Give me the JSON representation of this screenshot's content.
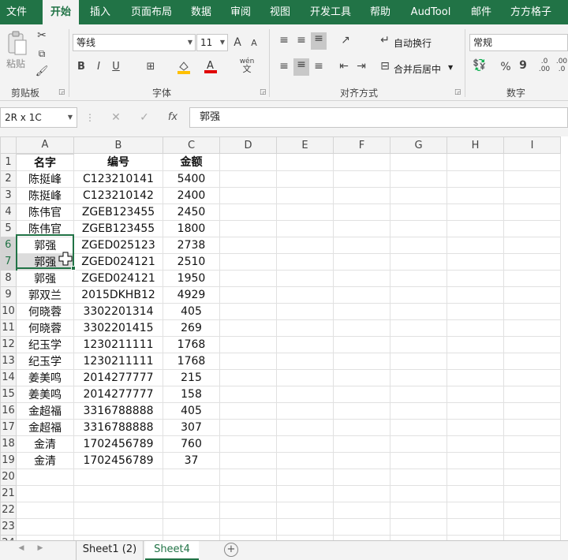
{
  "menu": {
    "tabs": [
      "文件",
      "开始",
      "插入",
      "页面布局",
      "数据",
      "审阅",
      "视图",
      "开发工具",
      "帮助",
      "AudTool",
      "邮件",
      "方方格子"
    ],
    "active": "开始"
  },
  "ribbon": {
    "clipboard": {
      "paste_label": "粘贴",
      "group_label": "剪贴板"
    },
    "font": {
      "font_name": "等线",
      "font_size": "11",
      "grow": "A",
      "shrink": "A",
      "bold": "B",
      "italic": "I",
      "underline": "U",
      "wen": "wén",
      "wen_sub": "文",
      "group_label": "字体"
    },
    "alignment": {
      "wrap_label": "自动换行",
      "merge_label": "合并后居中",
      "group_label": "对齐方式"
    },
    "number": {
      "format": "常规",
      "percent": "%",
      "comma": "9",
      "inc_dec": ".0",
      "inc_dec2": ".00",
      "group_label": "数字"
    }
  },
  "formula_bar": {
    "name_box": "2R x 1C",
    "fx": "fx",
    "content": "郭强"
  },
  "columns": [
    "A",
    "B",
    "C",
    "D",
    "E",
    "F",
    "G",
    "H",
    "I"
  ],
  "rows": [
    [
      "名字",
      "编号",
      "金额"
    ],
    [
      "陈挺峰",
      "C123210141",
      "5400"
    ],
    [
      "陈挺峰",
      "C123210142",
      "2400"
    ],
    [
      "陈伟官",
      "ZGEB123455",
      "2450"
    ],
    [
      "陈伟官",
      "ZGEB123455",
      "1800"
    ],
    [
      "郭强",
      "ZGED025123",
      "2738"
    ],
    [
      "郭强",
      "ZGED024121",
      "2510"
    ],
    [
      "郭强",
      "ZGED024121",
      "1950"
    ],
    [
      "郭双兰",
      "2015DKHB12",
      "4929"
    ],
    [
      "何晓蓉",
      "3302201314",
      "405"
    ],
    [
      "何晓蓉",
      "3302201415",
      "269"
    ],
    [
      "纪玉学",
      "1230211111",
      "1768"
    ],
    [
      "纪玉学",
      "1230211111",
      "1768"
    ],
    [
      "姜美鸣",
      "2014277777",
      "215"
    ],
    [
      "姜美鸣",
      "2014277777",
      "158"
    ],
    [
      "金超福",
      "3316788888",
      "405"
    ],
    [
      "金超福",
      "3316788888",
      "307"
    ],
    [
      "金清",
      "1702456789",
      "760"
    ],
    [
      "金清",
      "1702456789",
      "37"
    ],
    [
      "",
      "",
      ""
    ],
    [
      "",
      "",
      ""
    ],
    [
      "",
      "",
      ""
    ],
    [
      "",
      "",
      ""
    ],
    [
      "",
      "",
      ""
    ]
  ],
  "sheet_tabs": [
    "Sheet1 (2)",
    "Sheet4"
  ],
  "active_sheet": "Sheet4",
  "add_sheet": "+",
  "colors": {
    "accent": "#217346"
  }
}
